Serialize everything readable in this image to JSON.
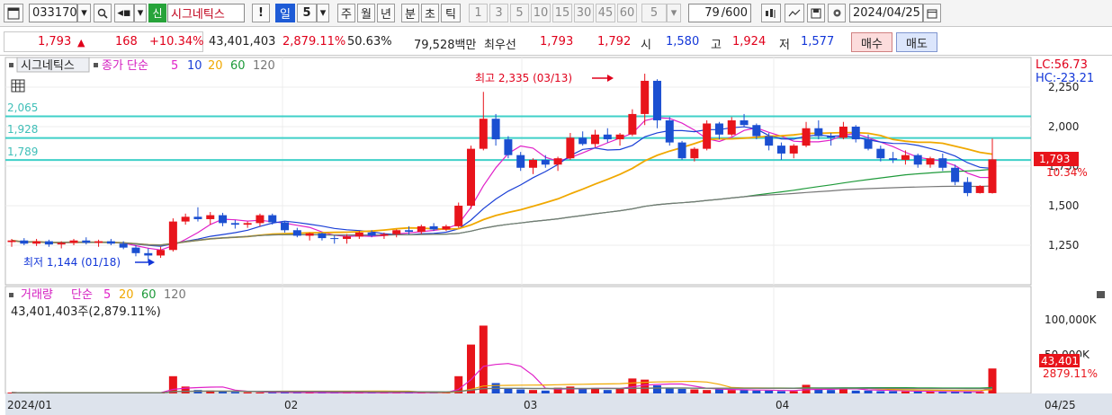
{
  "toolbar": {
    "code": "033170",
    "new_badge": "신",
    "stock_name": "시그네틱스",
    "alert_label": "!",
    "period_day": "일",
    "period_num": "5",
    "periods": [
      "주",
      "월",
      "년",
      "분",
      "초",
      "틱"
    ],
    "intervals": [
      "1",
      "3",
      "5",
      "10",
      "15",
      "30",
      "45",
      "60"
    ],
    "interval_select": "5",
    "count": "79",
    "count_max": "/600",
    "date": "2024/04/25"
  },
  "quote": {
    "price": "1,793",
    "arrow": "▲",
    "change": "168",
    "change_pct": "+10.34%",
    "volume": "43,401,403",
    "volume_ratio": "2,879.11%",
    "turnover_pct": "50.63%",
    "amount": "79,528백만",
    "best_label": "최우선",
    "best_ask": "1,793",
    "best_bid": "1,792",
    "open_label": "시",
    "open": "1,580",
    "high_label": "고",
    "high": "1,924",
    "low_label": "저",
    "low": "1,577",
    "buy_label": "매수",
    "sell_label": "매도"
  },
  "price_panel": {
    "legend_name": "시그네틱스",
    "legend_ma": "종가 단순",
    "legend_periods": [
      "5",
      "10",
      "20",
      "60",
      "120"
    ],
    "lc": "LC:56.73",
    "hc": "HC:-23.21",
    "level_labels": [
      "2,065",
      "1,928",
      "1,789"
    ],
    "y_ticks": [
      "2,250",
      "2,000",
      "1,750",
      "1,500",
      "1,250"
    ],
    "current_price": "1,793",
    "current_pct": "10.34%",
    "annot_high": "최고 2,335 (03/13)",
    "annot_low": "최저 1,144 (01/18)"
  },
  "volume_panel": {
    "legend_name": "거래량",
    "legend_ma": "단순",
    "legend_periods": [
      "5",
      "20",
      "60",
      "120"
    ],
    "info": "43,401,403주(2,879.11%)",
    "y_ticks": [
      "100,000K",
      "50,000K"
    ],
    "current": "43,401K",
    "current_pct": "2879.11%"
  },
  "x_axis": {
    "labels": [
      "2024/01",
      "02",
      "03",
      "04"
    ],
    "last": "04/25"
  },
  "colors": {
    "up": "#e8141b",
    "down": "#1b4fd1",
    "ma5": "#e020c8",
    "ma10": "#1a3fd6",
    "ma20": "#f0a800",
    "ma60": "#1e9a3a",
    "ma120": "#777777",
    "level": "#3fd0c8"
  },
  "chart_data": {
    "type": "candlestick",
    "title": "시그네틱스",
    "levels": [
      2065,
      1928,
      1789
    ],
    "candles": [
      [
        1270,
        1290,
        1240,
        1280
      ],
      [
        1280,
        1295,
        1250,
        1260
      ],
      [
        1260,
        1290,
        1245,
        1275
      ],
      [
        1275,
        1285,
        1240,
        1255
      ],
      [
        1255,
        1275,
        1230,
        1265
      ],
      [
        1265,
        1290,
        1250,
        1280
      ],
      [
        1280,
        1300,
        1255,
        1265
      ],
      [
        1265,
        1285,
        1240,
        1275
      ],
      [
        1275,
        1290,
        1250,
        1260
      ],
      [
        1260,
        1275,
        1225,
        1235
      ],
      [
        1235,
        1250,
        1180,
        1200
      ],
      [
        1200,
        1230,
        1144,
        1185
      ],
      [
        1185,
        1240,
        1170,
        1220
      ],
      [
        1220,
        1420,
        1210,
        1400
      ],
      [
        1400,
        1450,
        1380,
        1430
      ],
      [
        1430,
        1490,
        1400,
        1415
      ],
      [
        1415,
        1460,
        1380,
        1440
      ],
      [
        1440,
        1455,
        1370,
        1390
      ],
      [
        1390,
        1410,
        1355,
        1380
      ],
      [
        1380,
        1400,
        1360,
        1390
      ],
      [
        1390,
        1450,
        1370,
        1440
      ],
      [
        1440,
        1450,
        1380,
        1395
      ],
      [
        1395,
        1400,
        1330,
        1345
      ],
      [
        1345,
        1360,
        1300,
        1310
      ],
      [
        1310,
        1330,
        1280,
        1325
      ],
      [
        1325,
        1330,
        1280,
        1295
      ],
      [
        1295,
        1310,
        1260,
        1290
      ],
      [
        1290,
        1320,
        1260,
        1305
      ],
      [
        1305,
        1340,
        1290,
        1330
      ],
      [
        1330,
        1345,
        1300,
        1310
      ],
      [
        1310,
        1330,
        1290,
        1320
      ],
      [
        1320,
        1350,
        1300,
        1345
      ],
      [
        1345,
        1370,
        1320,
        1335
      ],
      [
        1335,
        1380,
        1320,
        1370
      ],
      [
        1370,
        1390,
        1340,
        1350
      ],
      [
        1350,
        1380,
        1340,
        1370
      ],
      [
        1370,
        1520,
        1360,
        1500
      ],
      [
        1500,
        1880,
        1480,
        1860
      ],
      [
        1860,
        2220,
        1850,
        2050
      ],
      [
        2050,
        2080,
        1880,
        1920
      ],
      [
        1920,
        1940,
        1800,
        1820
      ],
      [
        1820,
        1840,
        1720,
        1740
      ],
      [
        1740,
        1800,
        1700,
        1790
      ],
      [
        1790,
        1820,
        1740,
        1760
      ],
      [
        1760,
        1810,
        1720,
        1800
      ],
      [
        1800,
        1960,
        1790,
        1930
      ],
      [
        1930,
        1970,
        1880,
        1890
      ],
      [
        1890,
        1980,
        1870,
        1950
      ],
      [
        1950,
        1990,
        1900,
        1920
      ],
      [
        1920,
        1960,
        1880,
        1950
      ],
      [
        1950,
        2110,
        1940,
        2080
      ],
      [
        2080,
        2335,
        2010,
        2290
      ],
      [
        2290,
        2300,
        1990,
        2040
      ],
      [
        2040,
        2060,
        1880,
        1900
      ],
      [
        1900,
        1910,
        1790,
        1800
      ],
      [
        1800,
        1870,
        1780,
        1860
      ],
      [
        1860,
        2040,
        1850,
        2020
      ],
      [
        2020,
        2030,
        1920,
        1950
      ],
      [
        1950,
        2060,
        1940,
        2040
      ],
      [
        2040,
        2080,
        2000,
        2010
      ],
      [
        2010,
        2020,
        1920,
        1940
      ],
      [
        1940,
        1960,
        1850,
        1880
      ],
      [
        1880,
        1900,
        1790,
        1830
      ],
      [
        1830,
        1890,
        1800,
        1880
      ],
      [
        1880,
        2030,
        1870,
        1990
      ],
      [
        1990,
        2040,
        1920,
        1940
      ],
      [
        1940,
        1960,
        1880,
        1930
      ],
      [
        1930,
        2030,
        1920,
        2000
      ],
      [
        2000,
        2010,
        1900,
        1920
      ],
      [
        1920,
        1950,
        1850,
        1860
      ],
      [
        1860,
        1880,
        1780,
        1800
      ],
      [
        1800,
        1840,
        1770,
        1790
      ],
      [
        1790,
        1850,
        1760,
        1820
      ],
      [
        1820,
        1830,
        1740,
        1760
      ],
      [
        1760,
        1810,
        1740,
        1800
      ],
      [
        1800,
        1830,
        1720,
        1740
      ],
      [
        1740,
        1760,
        1630,
        1650
      ],
      [
        1650,
        1680,
        1560,
        1580
      ],
      [
        1580,
        1630,
        1577,
        1625
      ],
      [
        1580,
        1924,
        1577,
        1793
      ]
    ],
    "volume_k": [
      1500,
      1100,
      1200,
      900,
      1000,
      1100,
      900,
      800,
      900,
      1100,
      1300,
      1500,
      1400,
      30000,
      12000,
      6000,
      5000,
      3200,
      2500,
      2000,
      1600,
      2000,
      1800,
      1500,
      1500,
      1300,
      1200,
      1200,
      1500,
      1300,
      1200,
      1400,
      1300,
      1500,
      1400,
      1300,
      30000,
      85000,
      118000,
      18000,
      9000,
      7000,
      6000,
      5000,
      10000,
      12000,
      8000,
      9000,
      6000,
      8000,
      26000,
      24000,
      14000,
      10000,
      8000,
      7000,
      6000,
      7000,
      6000,
      6000,
      5000,
      5000,
      4000,
      4000,
      15000,
      7000,
      6000,
      8000,
      5000,
      5000,
      4000,
      4000,
      3500,
      3500,
      3000,
      3000,
      3500,
      3000,
      2500,
      43401
    ]
  }
}
